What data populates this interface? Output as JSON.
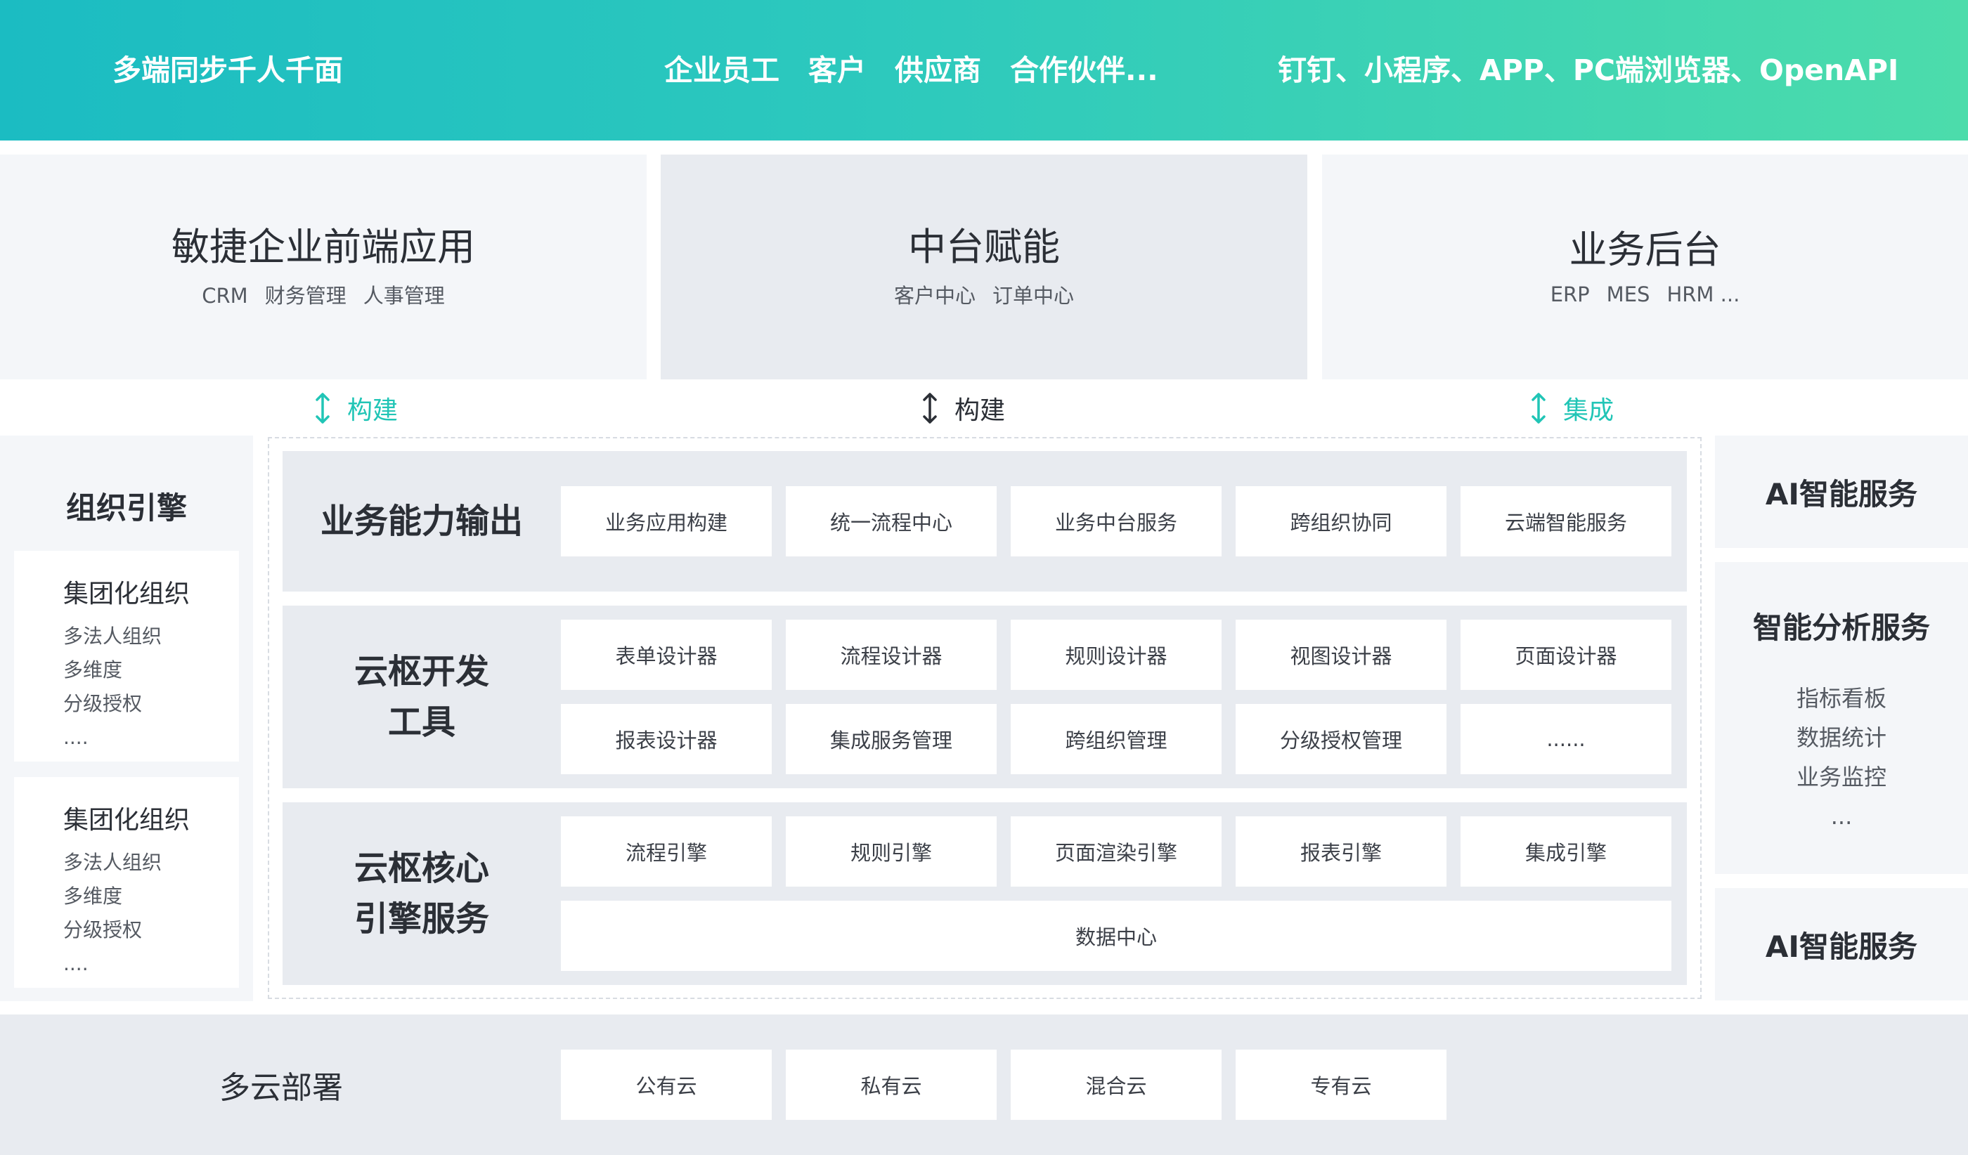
{
  "banner": {
    "left": "多端同步千人千面",
    "middle": "企业员工　客户　供应商　合作伙伴...",
    "right": "钉钉、小程序、APP、PC端浏览器、OpenAPI"
  },
  "top_columns": [
    {
      "title": "敏捷企业前端应用",
      "items": [
        "CRM",
        "财务管理",
        "人事管理"
      ]
    },
    {
      "title": "中台赋能",
      "items": [
        "客户中心",
        "订单中心"
      ]
    },
    {
      "title": "业务后台",
      "items": [
        "ERP",
        "MES",
        "HRM ..."
      ]
    }
  ],
  "arrows": [
    {
      "label": "构建",
      "color": "#21c5b6"
    },
    {
      "label": "构建",
      "color": "#2b2f36"
    },
    {
      "label": "集成",
      "color": "#21c5b6"
    }
  ],
  "left_panel": {
    "title": "组织引擎",
    "cards": [
      {
        "title": "集团化组织",
        "items": [
          "多法人组织",
          "多维度",
          "分级授权",
          "...."
        ]
      },
      {
        "title": "集团化组织",
        "items": [
          "多法人组织",
          "多维度",
          "分级授权",
          "...."
        ]
      }
    ]
  },
  "right_panel": {
    "top_title": "AI智能服务",
    "analysis_title": "智能分析服务",
    "analysis_items": [
      "指标看板",
      "数据统计",
      "业务监控",
      "..."
    ],
    "bottom_title": "AI智能服务"
  },
  "rows": {
    "business_output": {
      "title": [
        "业务能力输出"
      ],
      "cells": [
        "业务应用构建",
        "统一流程中心",
        "业务中台服务",
        "跨组织协同",
        "云端智能服务"
      ]
    },
    "dev_tools": {
      "title": [
        "云枢开发",
        "工具"
      ],
      "cells_row1": [
        "表单设计器",
        "流程设计器",
        "规则设计器",
        "视图设计器",
        "页面设计器"
      ],
      "cells_row2": [
        "报表设计器",
        "集成服务管理",
        "跨组织管理",
        "分级授权管理",
        "......"
      ]
    },
    "core_engine": {
      "title": [
        "云枢核心",
        "引擎服务"
      ],
      "cells_row1": [
        "流程引擎",
        "规则引擎",
        "页面渲染引擎",
        "报表引擎",
        "集成引擎"
      ],
      "data_center": "数据中心"
    }
  },
  "deploy": {
    "title": "多云部署",
    "cells": [
      "公有云",
      "私有云",
      "混合云",
      "专有云"
    ]
  },
  "colors": {
    "banner_start": "#1bbcc2",
    "banner_end": "#4cdcab",
    "panel_bg": "#f4f6f9",
    "row_bg": "#e8ebf0",
    "accent": "#21c5b6"
  }
}
